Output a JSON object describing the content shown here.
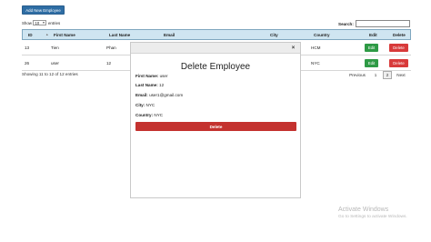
{
  "toolbar": {
    "add_label": "Add New Employee"
  },
  "length": {
    "show_label": "Show",
    "value": "10",
    "entries_label": "entries"
  },
  "search": {
    "label": "Search:",
    "placeholder": ""
  },
  "table": {
    "columns": [
      "ID",
      "First Name",
      "Last Name",
      "Email",
      "City",
      "Country",
      "Edit",
      "Delete"
    ],
    "rows": [
      {
        "id": "13",
        "first_name": "Tien",
        "last_name": "Phan",
        "email": "",
        "city": "",
        "country": "HCM",
        "edit_label": "Edit",
        "delete_label": "Delete"
      },
      {
        "id": "26",
        "first_name": "user",
        "last_name": "12",
        "email": "",
        "city": "",
        "country": "NYC",
        "edit_label": "Edit",
        "delete_label": "Delete"
      }
    ]
  },
  "info": "Showing 11 to 12 of 12 entries",
  "pagination": {
    "previous": "Previous",
    "pages": [
      "1",
      "2"
    ],
    "current": "2",
    "next": "Next"
  },
  "modal": {
    "close_label": "×",
    "title": "Delete Employee",
    "fields": [
      {
        "label": "First Name:",
        "value": "user"
      },
      {
        "label": "Last Name:",
        "value": "12"
      },
      {
        "label": "Email:",
        "value": "user1@gmail.com"
      },
      {
        "label": "City:",
        "value": "NYC"
      },
      {
        "label": "Country:",
        "value": "NYC"
      }
    ],
    "delete_label": "Delete"
  },
  "watermark": {
    "line1": "Activate Windows",
    "line2": "Go to Settings to activate Windows."
  },
  "colors": {
    "primary": "#2e6da4",
    "header_bg": "#cfe5f1",
    "edit": "#2e9a45",
    "delete": "#d83a3a",
    "modal_delete": "#c4322f"
  }
}
